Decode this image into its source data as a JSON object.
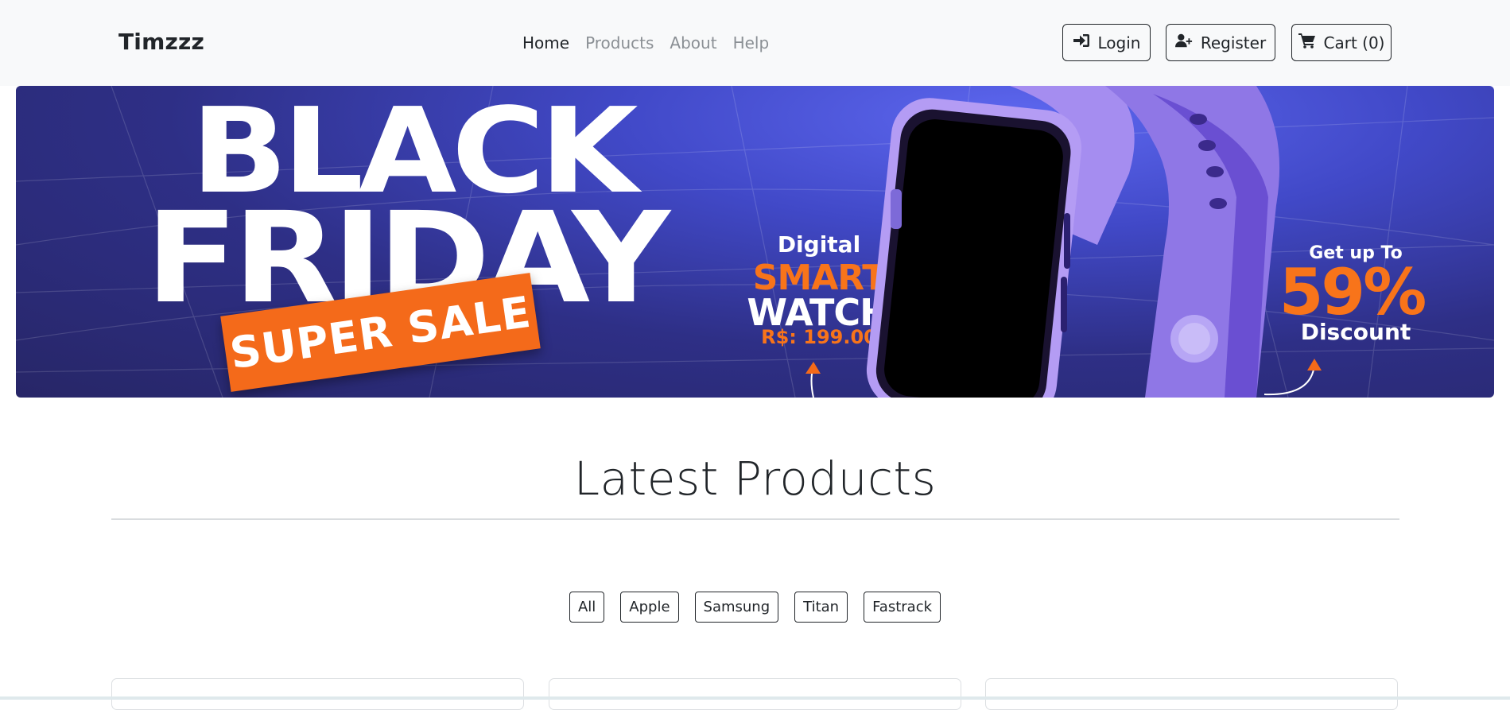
{
  "navbar": {
    "brand": "Timzzz",
    "links": [
      {
        "label": "Home",
        "active": true
      },
      {
        "label": "Products",
        "active": false
      },
      {
        "label": "About",
        "active": false
      },
      {
        "label": "Help",
        "active": false
      }
    ],
    "buttons": {
      "login": {
        "label": "Login",
        "icon": "sign-in-icon"
      },
      "register": {
        "label": "Register",
        "icon": "user-plus-icon"
      },
      "cart": {
        "label": "Cart (0)",
        "icon": "cart-icon"
      }
    }
  },
  "hero": {
    "headline_line1": "BLACK",
    "headline_line2": "FRIDAY",
    "badge": "SUPER SALE",
    "product_line1": "Digital",
    "product_line2": "SMART",
    "product_line3": "WATCH",
    "price": "R$: 199.00",
    "offer_line1": "Get up To",
    "offer_percent": "59%",
    "offer_line2": "Discount",
    "colors": {
      "background": "#3a3fb0",
      "accent": "#f46a1a",
      "text": "#ffffff"
    }
  },
  "main": {
    "section_title": "Latest Products",
    "filters": [
      "All",
      "Apple",
      "Samsung",
      "Titan",
      "Fastrack"
    ]
  }
}
